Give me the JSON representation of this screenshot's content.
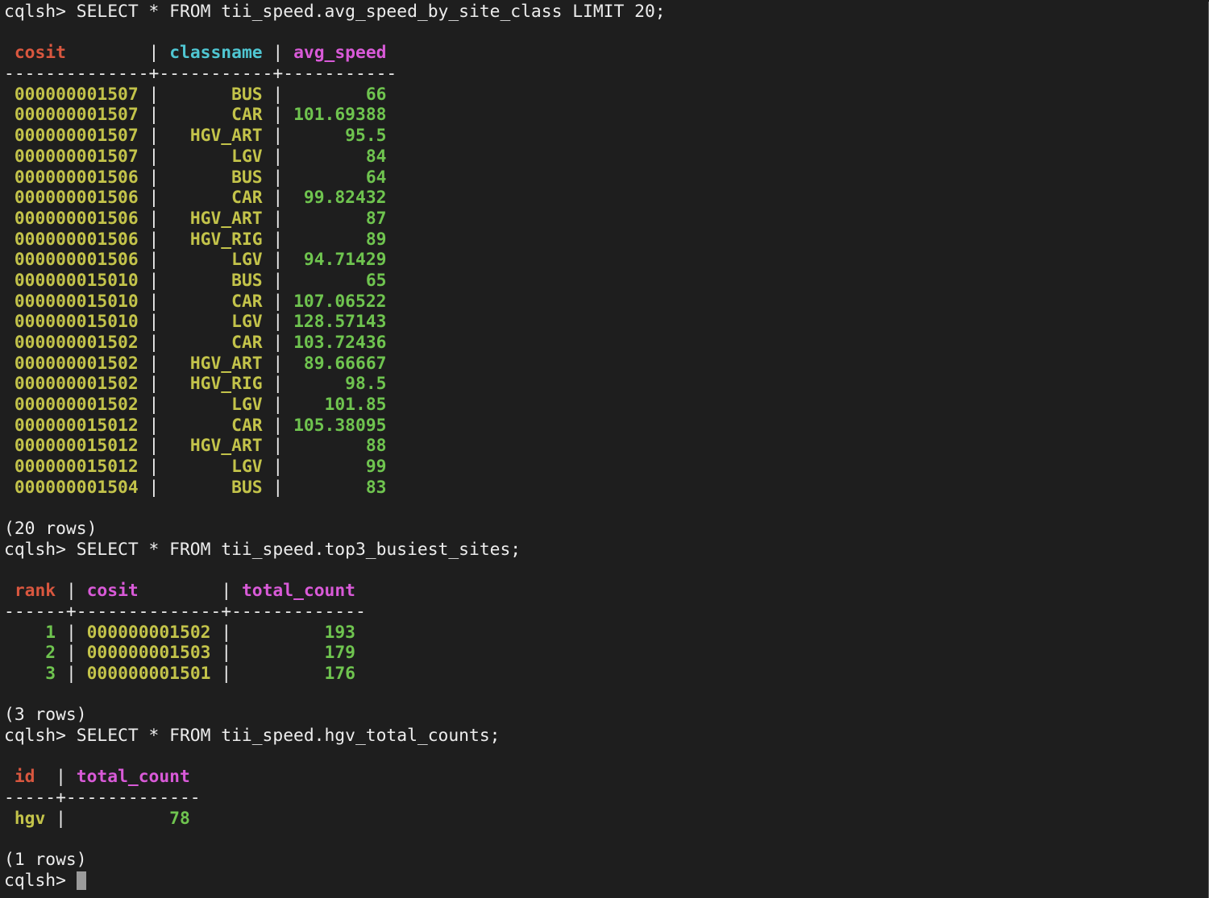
{
  "terminal": {
    "prompt": "cqlsh> ",
    "colors": {
      "background": "#1e1e1e",
      "header_red": "#d9573f",
      "header_cyan": "#4fc6d2",
      "header_magenta": "#d95ad8",
      "text_yellow": "#c3c34a",
      "number_green": "#6fc44f"
    }
  },
  "query1": {
    "command": "SELECT * FROM tii_speed.avg_speed_by_site_class LIMIT 20;",
    "columns": [
      "cosit",
      "classname",
      "avg_speed"
    ],
    "rows": [
      [
        "000000001507",
        "BUS",
        "66"
      ],
      [
        "000000001507",
        "CAR",
        "101.69388"
      ],
      [
        "000000001507",
        "HGV_ART",
        "95.5"
      ],
      [
        "000000001507",
        "LGV",
        "84"
      ],
      [
        "000000001506",
        "BUS",
        "64"
      ],
      [
        "000000001506",
        "CAR",
        "99.82432"
      ],
      [
        "000000001506",
        "HGV_ART",
        "87"
      ],
      [
        "000000001506",
        "HGV_RIG",
        "89"
      ],
      [
        "000000001506",
        "LGV",
        "94.71429"
      ],
      [
        "000000015010",
        "BUS",
        "65"
      ],
      [
        "000000015010",
        "CAR",
        "107.06522"
      ],
      [
        "000000015010",
        "LGV",
        "128.57143"
      ],
      [
        "000000001502",
        "CAR",
        "103.72436"
      ],
      [
        "000000001502",
        "HGV_ART",
        "89.66667"
      ],
      [
        "000000001502",
        "HGV_RIG",
        "98.5"
      ],
      [
        "000000001502",
        "LGV",
        "101.85"
      ],
      [
        "000000015012",
        "CAR",
        "105.38095"
      ],
      [
        "000000015012",
        "HGV_ART",
        "88"
      ],
      [
        "000000015012",
        "LGV",
        "99"
      ],
      [
        "000000001504",
        "BUS",
        "83"
      ]
    ],
    "row_count": "(20 rows)"
  },
  "query2": {
    "command": "SELECT * FROM tii_speed.top3_busiest_sites;",
    "columns": [
      "rank",
      "cosit",
      "total_count"
    ],
    "rows": [
      [
        "1",
        "000000001502",
        "193"
      ],
      [
        "2",
        "000000001503",
        "179"
      ],
      [
        "3",
        "000000001501",
        "176"
      ]
    ],
    "row_count": "(3 rows)"
  },
  "query3": {
    "command": "SELECT * FROM tii_speed.hgv_total_counts;",
    "columns": [
      "id",
      "total_count"
    ],
    "rows": [
      [
        "hgv",
        "78"
      ]
    ],
    "row_count": "(1 rows)"
  }
}
